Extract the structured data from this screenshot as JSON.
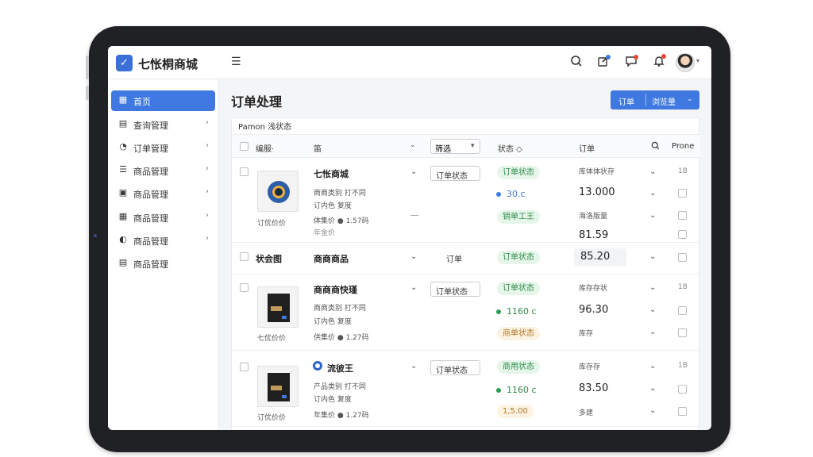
{
  "app": {
    "logo_text": "七怅桐商城",
    "logo_glyph": "✓"
  },
  "header": {
    "menu_icon": "☰",
    "icons": [
      "search-icon",
      "edit-icon",
      "message-icon",
      "bell-icon"
    ]
  },
  "sidebar": {
    "items": [
      {
        "label": "首页",
        "icon": "▦",
        "active": true
      },
      {
        "label": "查询管理",
        "icon": "▤",
        "arrow": "›"
      },
      {
        "label": "订单管理",
        "icon": "◔",
        "arrow": "›"
      },
      {
        "label": "商品管理",
        "icon": "☰",
        "arrow": "›"
      },
      {
        "label": "商品管理",
        "icon": "▣",
        "arrow": "›"
      },
      {
        "label": "商品管理",
        "icon": "▦",
        "arrow": "›"
      },
      {
        "label": "商品管理",
        "icon": "◐",
        "arrow": "›"
      },
      {
        "label": "商品管理",
        "icon": "▤"
      }
    ]
  },
  "page": {
    "title": "订单处理",
    "primary_button_a": "订单",
    "primary_button_b": "浏览量",
    "primary_caret": "⌄"
  },
  "table": {
    "filter_label": "Pamon 浅状态",
    "headers": {
      "col1": "编服·",
      "col2": "笛",
      "select": "筛选",
      "status": "状态 ◇",
      "order": "订单",
      "phone": "Prone"
    },
    "rows": [
      {
        "name": "七怅商城",
        "desc1": "商商类别 打不同",
        "desc2": "订内色 复度",
        "meta": "体集价 ● 1.57码",
        "meta2": "年金价",
        "thumb_caption": "订优价价",
        "dropdown": "订单状态",
        "tag1": "订单状态",
        "val": "30.c",
        "tag2": "销单工王",
        "label1": "库体体状存",
        "amount1": "13.000",
        "label2": "海洛版量",
        "amount2": "81.59",
        "extra1": "1B"
      },
      {
        "col1": "状会图",
        "col2": "商商商品",
        "center": "订单",
        "tag": "订单状态",
        "amount": "85.20"
      },
      {
        "name": "商商商快瑾",
        "desc1": "商商类别 打不同",
        "desc2": "订内色 复度",
        "meta": "供集价 ● 1.27码",
        "thumb_caption": "七优价价",
        "dropdown": "订单状态",
        "tag1": "订单状态",
        "val": "1160 c",
        "tag2": "商单状态",
        "label1": "库存存状",
        "amount1": "96.30",
        "label2": "库存",
        "extra1": "1B"
      },
      {
        "name": "流彼王",
        "desc1": "产品类别 打不同",
        "desc2": "订内色 复度",
        "meta": "年集价 ● 1.27码",
        "thumb_caption": "订优价价",
        "dropdown": "订单状态",
        "tag1": "商用状态",
        "val": "1160 c",
        "tag2": "1,5.00",
        "label1": "库存存",
        "amount1": "83.50",
        "label2": "多建",
        "extra1": "1B"
      }
    ]
  }
}
